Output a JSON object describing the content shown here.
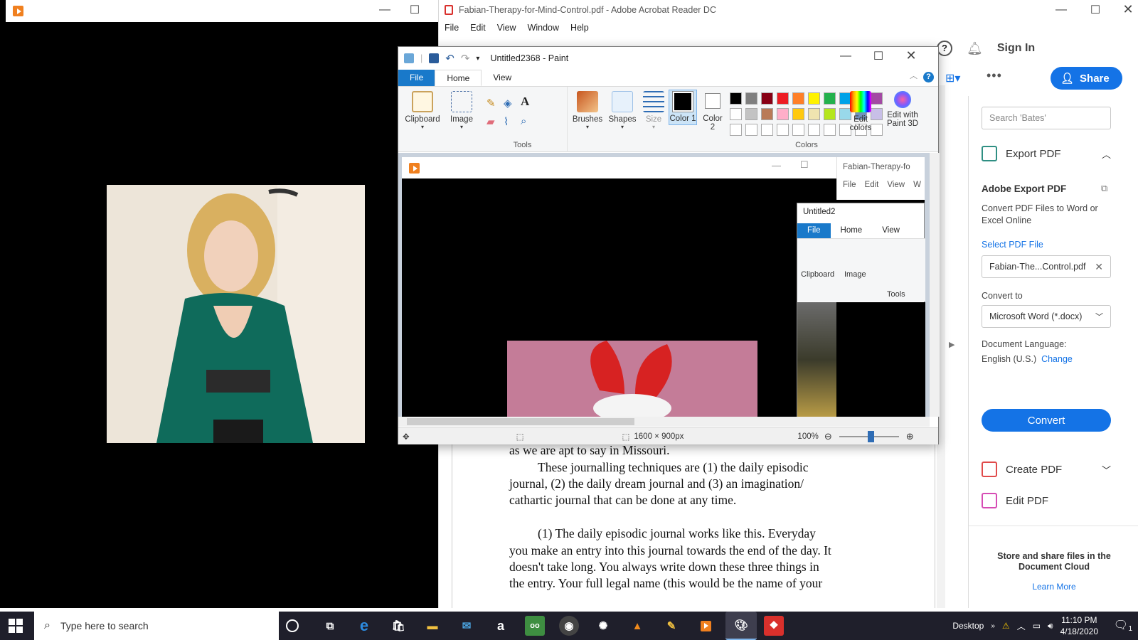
{
  "acrobat": {
    "window_title": "Fabian-Therapy-for-Mind-Control.pdf - Adobe Acrobat Reader DC",
    "menu": [
      "File",
      "Edit",
      "View",
      "Window",
      "Help"
    ],
    "sign_in": "Sign In",
    "share": "Share",
    "search_placeholder": "Search 'Bates'",
    "export_header": "Export PDF",
    "adobe_export_title": "Adobe Export PDF",
    "adobe_export_desc": "Convert PDF Files to Word or Excel Online",
    "select_file_label": "Select PDF File",
    "file_value": "Fabian-The...Control.pdf",
    "convert_to_label": "Convert to",
    "convert_to_value": "Microsoft Word (*.docx)",
    "doc_language_label": "Document Language:",
    "doc_language_value": "English (U.S.)",
    "change_link": "Change",
    "convert_button": "Convert",
    "create_pdf": "Create PDF",
    "edit_pdf": "Edit PDF",
    "cloud_promo": "Store and share files in the Document Cloud",
    "learn_more": "Learn More",
    "doc_lines": [
      "as we are apt to say in Missouri.",
      "These journalling techniques are (1) the daily episodic",
      "journal, (2) the daily dream journal and (3) an imagination/",
      "cathartic journal that can be done at any time.",
      "(1)  The daily episodic journal works like this. Everyday",
      "you make an entry into this journal towards the end of the day. It",
      "doesn't take long. You always write down these three things in",
      "the entry. Your full legal name (this would be the name of your"
    ]
  },
  "paint": {
    "title": "Untitled2368 - Paint",
    "tabs": [
      "File",
      "Home",
      "View"
    ],
    "groups": {
      "clipboard": "Clipboard",
      "image": "Image",
      "tools": "Tools",
      "brushes": "Brushes",
      "shapes": "Shapes",
      "size": "Size",
      "color1": "Color 1",
      "color2": "Color 2",
      "colors": "Colors",
      "edit_colors": "Edit colors",
      "edit_paint3d": "Edit with Paint 3D"
    },
    "palette_row1": [
      "#000000",
      "#7f7f7f",
      "#880015",
      "#ed1c24",
      "#ff7f27",
      "#fff200",
      "#22b14c",
      "#00a2e8",
      "#3f48cc",
      "#a349a4"
    ],
    "palette_row2": [
      "#ffffff",
      "#c3c3c3",
      "#b97a57",
      "#ffaec9",
      "#ffc90e",
      "#efe4b0",
      "#b5e61d",
      "#99d9ea",
      "#7092be",
      "#c8bfe7"
    ],
    "nested_acrobat_title": "Fabian-Therapy-fo",
    "nested_acrobat_menu": [
      "File",
      "Edit",
      "View",
      "W"
    ],
    "nested_paint_title": "Untitled2",
    "status_size": "1600 × 900px",
    "zoom": "100%"
  },
  "taskbar": {
    "search_placeholder": "Type here to search",
    "desktop_label": "Desktop",
    "time": "11:10 PM",
    "date": "4/18/2020",
    "notification_count": "1"
  }
}
